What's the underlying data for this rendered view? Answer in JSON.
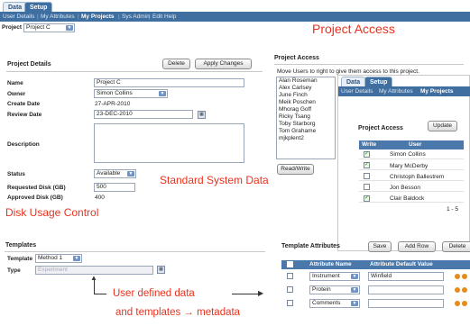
{
  "app": {
    "tabs": [
      {
        "label": "Data"
      },
      {
        "label": "Setup"
      }
    ],
    "nav": [
      "User Details",
      "My Attributes",
      "My Projects",
      "Sys Admin",
      "Edit Help"
    ]
  },
  "project_selector": {
    "label": "Project",
    "value": "Project C"
  },
  "callouts": {
    "project_access": "Project Access",
    "standard_system_data": "Standard System Data",
    "disk_usage": "Disk Usage Control",
    "user_defined_1": "User defined data",
    "user_defined_2": "and templates → metadata"
  },
  "project_details": {
    "title": "Project Details",
    "delete_label": "Delete",
    "apply_label": "Apply Changes",
    "name_label": "Name",
    "name_value": "Project C",
    "owner_label": "Owner",
    "owner_value": "Simon Collins",
    "create_label": "Create Date",
    "create_value": "27-APR-2010",
    "review_label": "Review Date",
    "review_value": "23-DEC-2010",
    "description_label": "Description",
    "status_label": "Status",
    "status_value": "Available",
    "requested_label": "Requested Disk (GB)",
    "requested_value": "500",
    "approved_label": "Approved Disk (GB)",
    "approved_value": "400"
  },
  "project_access": {
    "title": "Project Access",
    "hint": "Move Users to right to give them access to this project.",
    "users": [
      "Alan Roseman",
      "Alex Carlsey",
      "June Finch",
      "Meik Poschen",
      "Mhorag Goff",
      "Ricky Tsang",
      "Toby Starborg",
      "Tom Grahame",
      "mjkplent2"
    ],
    "readwrite_label": "Read/Write"
  },
  "inset": {
    "tabs": [
      {
        "label": "Data"
      },
      {
        "label": "Setup"
      }
    ],
    "nav": [
      "User Details",
      "My Attributes",
      "My Projects"
    ],
    "title": "Project Access",
    "update_label": "Update",
    "col_write": "Write",
    "col_user": "User",
    "rows": [
      {
        "write": true,
        "user": "Simon Collins"
      },
      {
        "write": true,
        "user": "Mary McDerby"
      },
      {
        "write": false,
        "user": "Christoph Ballestrem"
      },
      {
        "write": false,
        "user": "Jon Besson"
      },
      {
        "write": true,
        "user": "Clair Baldock"
      }
    ],
    "pagination": "1 - 5",
    "check_glyph": "✓"
  },
  "templates": {
    "title": "Templates",
    "template_label": "Template",
    "template_value": "Method 1",
    "type_label": "Type",
    "type_value": "Experiment"
  },
  "template_attributes": {
    "title": "Template Attributes",
    "save_label": "Save",
    "add_row_label": "Add Row",
    "delete_label": "Delete",
    "col_name": "Attribute Name",
    "col_default": "Attribute Default Value",
    "rows": [
      {
        "name": "Instrument",
        "default": "Winfield"
      },
      {
        "name": "Protein",
        "default": ""
      },
      {
        "name": "Comments",
        "default": ""
      }
    ]
  },
  "colors": {
    "accent": "#3f6fa0",
    "callout": "#e8321e",
    "grid_header": "#4a78ab"
  }
}
